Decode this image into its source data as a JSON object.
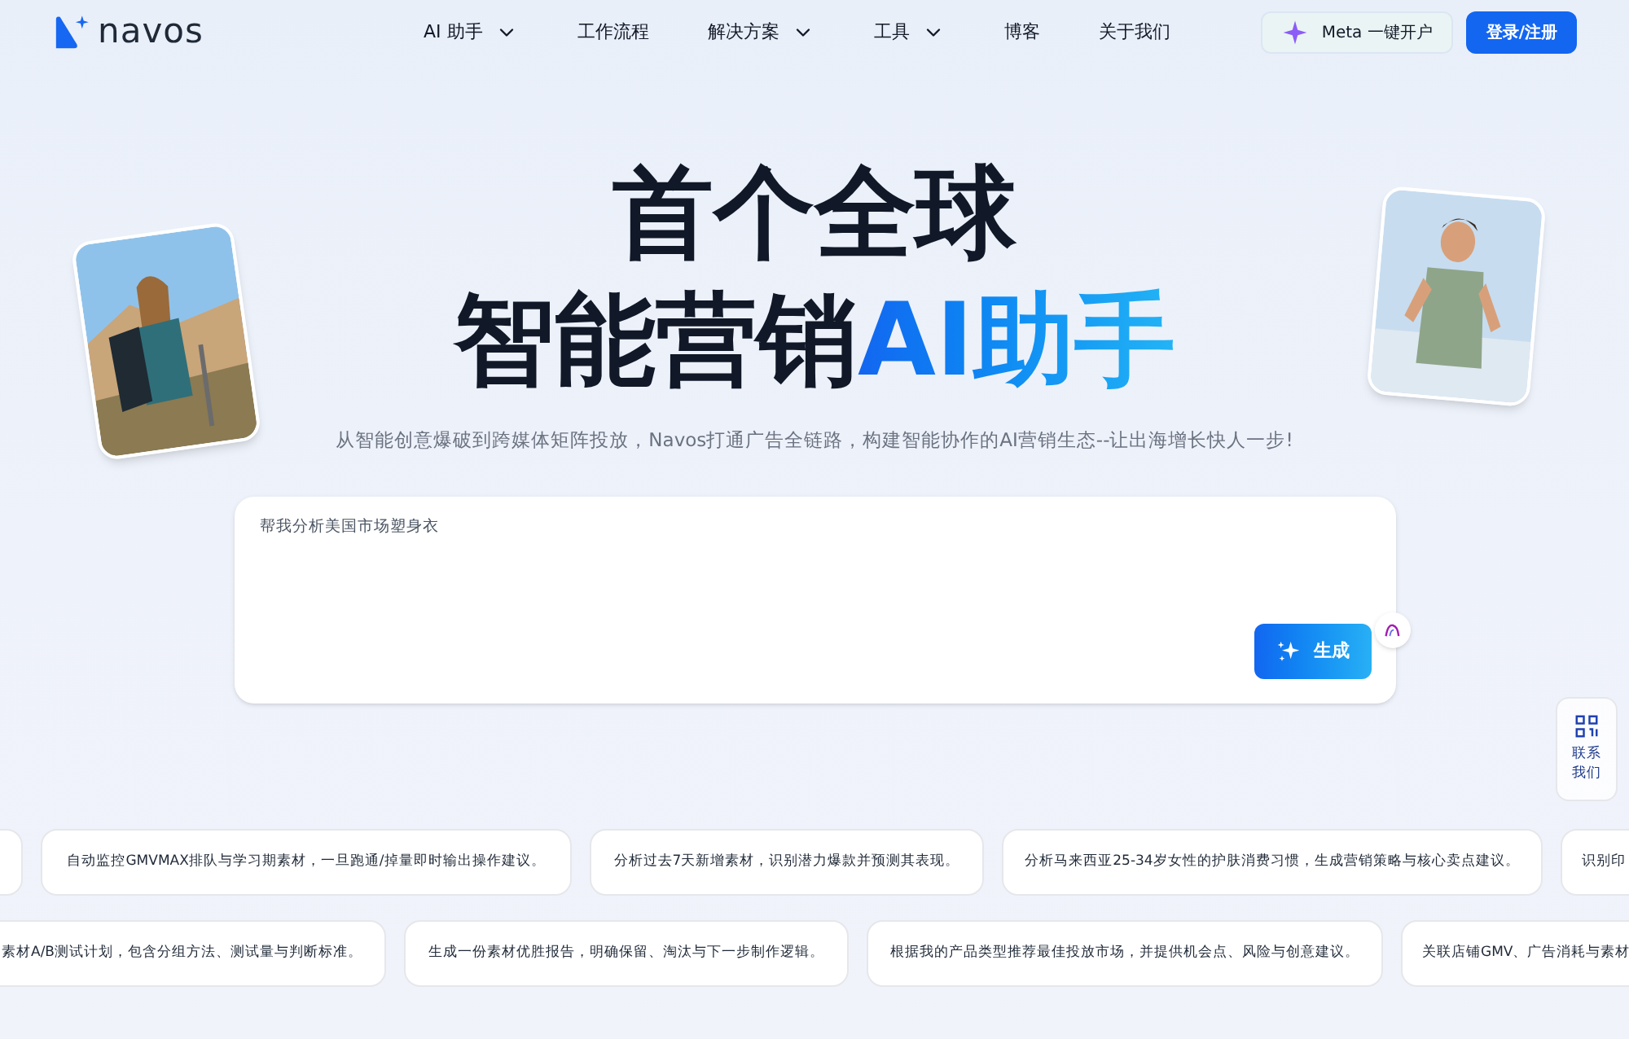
{
  "brand": {
    "name": "navos"
  },
  "nav": [
    {
      "label": "AI 助手",
      "has_menu": true
    },
    {
      "label": "工作流程",
      "has_menu": false
    },
    {
      "label": "解决方案",
      "has_menu": true
    },
    {
      "label": "工具",
      "has_menu": true
    },
    {
      "label": "博客",
      "has_menu": false
    },
    {
      "label": "关于我们",
      "has_menu": false
    }
  ],
  "meta_button": "Meta 一键开户",
  "login_button": "登录/注册",
  "hero": {
    "title_line1": "首个全球",
    "title_line2": "智能营销",
    "title_highlight": "AI助手",
    "subtitle": "从智能创意爆破到跨媒体矩阵投放，Navos打通广告全链路，构建智能协作的AI营销生态--让出海增长快人一步!"
  },
  "prompt": {
    "placeholder": "帮我分析美国市场塑身衣",
    "generate_button": "生成"
  },
  "contact": {
    "label": "联系我们"
  },
  "suggestions": [
    [
      "自动监控GMVMAX排队与学习期素材，一旦跑通/掉量即时输出操作建议。",
      "分析过去7天新增素材，识别潜力爆款并预测其表现。",
      "分析马来西亚25-34岁女性的护肤消费习惯，生成营销策略与核心卖点建议。",
      "识别印"
    ],
    [
      "素材A/B测试计划，包含分组方法、测试量与判断标准。",
      "生成一份素材优胜报告，明确保留、淘汰与下一步制作逻辑。",
      "根据我的产品类型推荐最佳投放市场，并提供机会点、风险与创意建议。",
      "关联店铺GMV、广告消耗与素材"
    ]
  ]
}
